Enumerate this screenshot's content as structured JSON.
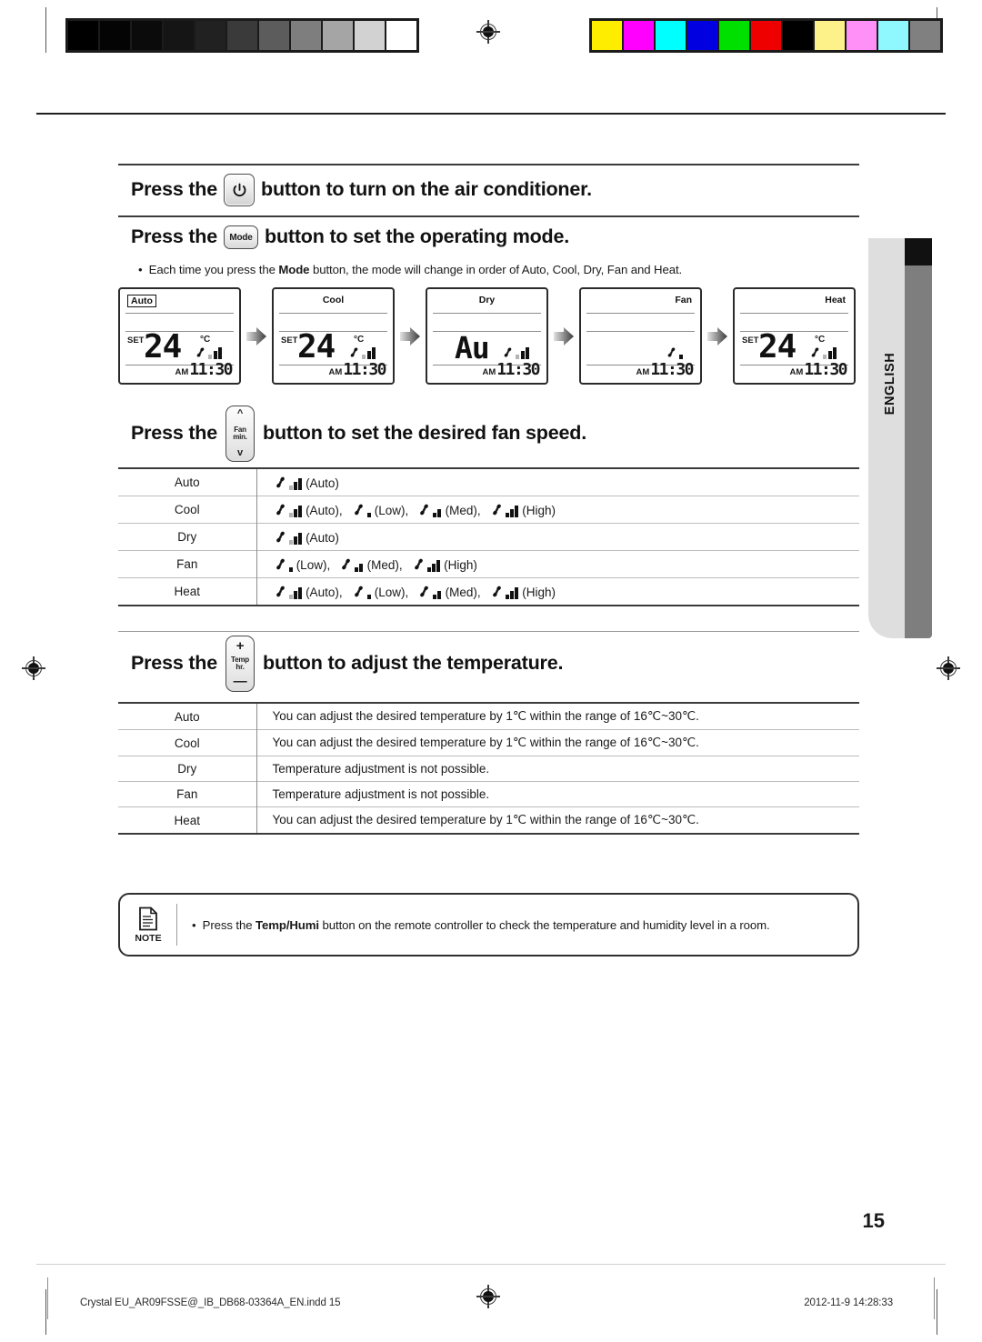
{
  "calibration": {
    "gray_bar": [
      "#000000",
      "#040404",
      "#0b0b0b",
      "#151515",
      "#212121",
      "#3a3a3a",
      "#5c5c5c",
      "#7e7e7e",
      "#a5a5a5",
      "#d2d2d2",
      "#ffffff"
    ],
    "color_bar": [
      "#ffed00",
      "#ff00ff",
      "#00ffff",
      "#0000e0",
      "#00e000",
      "#ee0000",
      "#000000",
      "#fdf18a",
      "#ff90f8",
      "#8ff8ff",
      "#808080"
    ]
  },
  "sections": {
    "power": {
      "lead": "Press the",
      "button_icon": "power-icon",
      "tail": "button to turn on the air conditioner."
    },
    "mode": {
      "lead": "Press the",
      "button_label": "Mode",
      "tail": "button to set the operating mode.",
      "bullet": "Each time you press the Mode button, the mode will change in order of Auto, Cool, Dry, Fan and Heat.",
      "bullet_bold": "Mode"
    },
    "fan": {
      "lead": "Press the",
      "button_top": "Fan",
      "button_bottom": "min.",
      "tail": "button to set the desired fan speed."
    },
    "temp": {
      "lead": "Press the",
      "button_top": "Temp",
      "button_bottom": "hr.",
      "plus": "+",
      "minus": "—",
      "tail": "button to adjust the temperature."
    }
  },
  "lcd_panels": [
    {
      "mode": "Auto",
      "selected": true,
      "label_align": "left",
      "set_label": "SET",
      "value": "24",
      "unit": "°C",
      "show_value": true,
      "fan_level": "auto",
      "am": "AM",
      "time": "11:30"
    },
    {
      "mode": "Cool",
      "selected": false,
      "label_align": "center",
      "set_label": "SET",
      "value": "24",
      "unit": "°C",
      "show_value": true,
      "fan_level": "auto",
      "am": "AM",
      "time": "11:30"
    },
    {
      "mode": "Dry",
      "selected": false,
      "label_align": "center",
      "set_label": "",
      "value": "Au",
      "unit": "",
      "show_value": true,
      "fan_level": "auto",
      "am": "AM",
      "time": "11:30"
    },
    {
      "mode": "Fan",
      "selected": false,
      "label_align": "right",
      "set_label": "",
      "value": "",
      "unit": "",
      "show_value": false,
      "fan_level": "low",
      "am": "AM",
      "time": "11:30"
    },
    {
      "mode": "Heat",
      "selected": false,
      "label_align": "right",
      "set_label": "SET",
      "value": "24",
      "unit": "°C",
      "show_value": true,
      "fan_level": "auto",
      "am": "AM",
      "time": "11:30"
    }
  ],
  "fan_table": {
    "rows": [
      {
        "mode": "Auto",
        "speeds": [
          {
            "level": "auto",
            "caption": "(Auto)"
          }
        ]
      },
      {
        "mode": "Cool",
        "speeds": [
          {
            "level": "auto",
            "caption": "(Auto),"
          },
          {
            "level": "low",
            "caption": "(Low),"
          },
          {
            "level": "med",
            "caption": "(Med),"
          },
          {
            "level": "high",
            "caption": "(High)"
          }
        ]
      },
      {
        "mode": "Dry",
        "speeds": [
          {
            "level": "auto",
            "caption": "(Auto)"
          }
        ]
      },
      {
        "mode": "Fan",
        "speeds": [
          {
            "level": "low",
            "caption": "(Low),"
          },
          {
            "level": "med",
            "caption": "(Med),"
          },
          {
            "level": "high",
            "caption": "(High)"
          }
        ]
      },
      {
        "mode": "Heat",
        "speeds": [
          {
            "level": "auto",
            "caption": "(Auto),"
          },
          {
            "level": "low",
            "caption": "(Low),"
          },
          {
            "level": "med",
            "caption": "(Med),"
          },
          {
            "level": "high",
            "caption": "(High)"
          }
        ]
      }
    ]
  },
  "temp_table": {
    "rows": [
      {
        "mode": "Auto",
        "text": "You can adjust the desired temperature by 1℃ within the range of 16℃~30℃."
      },
      {
        "mode": "Cool",
        "text": "You can adjust the desired temperature by 1℃ within the range of 16℃~30℃."
      },
      {
        "mode": "Dry",
        "text": "Temperature adjustment is not possible."
      },
      {
        "mode": "Fan",
        "text": "Temperature adjustment is not possible."
      },
      {
        "mode": "Heat",
        "text": "You can adjust the desired temperature by 1℃ within the range of 16℃~30℃."
      }
    ]
  },
  "note": {
    "label": "NOTE",
    "text_before": "Press the ",
    "text_bold": "Temp/Humi",
    "text_after": " button on the remote controller to check the temperature and humidity level in a room."
  },
  "side_tab": {
    "language": "ENGLISH"
  },
  "footer": {
    "page_number": "15",
    "file_name": "Crystal  EU_AR09FSSE@_IB_DB68-03364A_EN.indd   15",
    "timestamp": "2012-11-9   14:28:33"
  }
}
